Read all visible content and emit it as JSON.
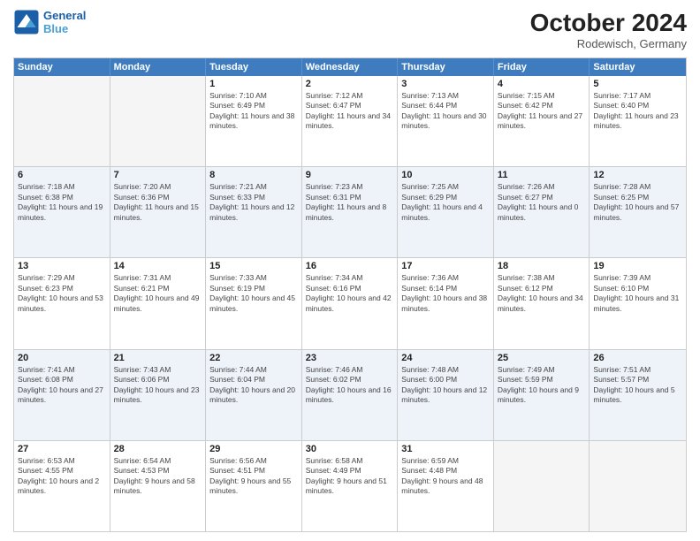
{
  "header": {
    "logo_text_line1": "General",
    "logo_text_line2": "Blue",
    "month": "October 2024",
    "location": "Rodewisch, Germany"
  },
  "weekdays": [
    "Sunday",
    "Monday",
    "Tuesday",
    "Wednesday",
    "Thursday",
    "Friday",
    "Saturday"
  ],
  "weeks": [
    [
      {
        "day": "",
        "info": "",
        "empty": true
      },
      {
        "day": "",
        "info": "",
        "empty": true
      },
      {
        "day": "1",
        "info": "Sunrise: 7:10 AM\nSunset: 6:49 PM\nDaylight: 11 hours and 38 minutes."
      },
      {
        "day": "2",
        "info": "Sunrise: 7:12 AM\nSunset: 6:47 PM\nDaylight: 11 hours and 34 minutes."
      },
      {
        "day": "3",
        "info": "Sunrise: 7:13 AM\nSunset: 6:44 PM\nDaylight: 11 hours and 30 minutes."
      },
      {
        "day": "4",
        "info": "Sunrise: 7:15 AM\nSunset: 6:42 PM\nDaylight: 11 hours and 27 minutes."
      },
      {
        "day": "5",
        "info": "Sunrise: 7:17 AM\nSunset: 6:40 PM\nDaylight: 11 hours and 23 minutes."
      }
    ],
    [
      {
        "day": "6",
        "info": "Sunrise: 7:18 AM\nSunset: 6:38 PM\nDaylight: 11 hours and 19 minutes."
      },
      {
        "day": "7",
        "info": "Sunrise: 7:20 AM\nSunset: 6:36 PM\nDaylight: 11 hours and 15 minutes."
      },
      {
        "day": "8",
        "info": "Sunrise: 7:21 AM\nSunset: 6:33 PM\nDaylight: 11 hours and 12 minutes."
      },
      {
        "day": "9",
        "info": "Sunrise: 7:23 AM\nSunset: 6:31 PM\nDaylight: 11 hours and 8 minutes."
      },
      {
        "day": "10",
        "info": "Sunrise: 7:25 AM\nSunset: 6:29 PM\nDaylight: 11 hours and 4 minutes."
      },
      {
        "day": "11",
        "info": "Sunrise: 7:26 AM\nSunset: 6:27 PM\nDaylight: 11 hours and 0 minutes."
      },
      {
        "day": "12",
        "info": "Sunrise: 7:28 AM\nSunset: 6:25 PM\nDaylight: 10 hours and 57 minutes."
      }
    ],
    [
      {
        "day": "13",
        "info": "Sunrise: 7:29 AM\nSunset: 6:23 PM\nDaylight: 10 hours and 53 minutes."
      },
      {
        "day": "14",
        "info": "Sunrise: 7:31 AM\nSunset: 6:21 PM\nDaylight: 10 hours and 49 minutes."
      },
      {
        "day": "15",
        "info": "Sunrise: 7:33 AM\nSunset: 6:19 PM\nDaylight: 10 hours and 45 minutes."
      },
      {
        "day": "16",
        "info": "Sunrise: 7:34 AM\nSunset: 6:16 PM\nDaylight: 10 hours and 42 minutes."
      },
      {
        "day": "17",
        "info": "Sunrise: 7:36 AM\nSunset: 6:14 PM\nDaylight: 10 hours and 38 minutes."
      },
      {
        "day": "18",
        "info": "Sunrise: 7:38 AM\nSunset: 6:12 PM\nDaylight: 10 hours and 34 minutes."
      },
      {
        "day": "19",
        "info": "Sunrise: 7:39 AM\nSunset: 6:10 PM\nDaylight: 10 hours and 31 minutes."
      }
    ],
    [
      {
        "day": "20",
        "info": "Sunrise: 7:41 AM\nSunset: 6:08 PM\nDaylight: 10 hours and 27 minutes."
      },
      {
        "day": "21",
        "info": "Sunrise: 7:43 AM\nSunset: 6:06 PM\nDaylight: 10 hours and 23 minutes."
      },
      {
        "day": "22",
        "info": "Sunrise: 7:44 AM\nSunset: 6:04 PM\nDaylight: 10 hours and 20 minutes."
      },
      {
        "day": "23",
        "info": "Sunrise: 7:46 AM\nSunset: 6:02 PM\nDaylight: 10 hours and 16 minutes."
      },
      {
        "day": "24",
        "info": "Sunrise: 7:48 AM\nSunset: 6:00 PM\nDaylight: 10 hours and 12 minutes."
      },
      {
        "day": "25",
        "info": "Sunrise: 7:49 AM\nSunset: 5:59 PM\nDaylight: 10 hours and 9 minutes."
      },
      {
        "day": "26",
        "info": "Sunrise: 7:51 AM\nSunset: 5:57 PM\nDaylight: 10 hours and 5 minutes."
      }
    ],
    [
      {
        "day": "27",
        "info": "Sunrise: 6:53 AM\nSunset: 4:55 PM\nDaylight: 10 hours and 2 minutes."
      },
      {
        "day": "28",
        "info": "Sunrise: 6:54 AM\nSunset: 4:53 PM\nDaylight: 9 hours and 58 minutes."
      },
      {
        "day": "29",
        "info": "Sunrise: 6:56 AM\nSunset: 4:51 PM\nDaylight: 9 hours and 55 minutes."
      },
      {
        "day": "30",
        "info": "Sunrise: 6:58 AM\nSunset: 4:49 PM\nDaylight: 9 hours and 51 minutes."
      },
      {
        "day": "31",
        "info": "Sunrise: 6:59 AM\nSunset: 4:48 PM\nDaylight: 9 hours and 48 minutes."
      },
      {
        "day": "",
        "info": "",
        "empty": true
      },
      {
        "day": "",
        "info": "",
        "empty": true
      }
    ]
  ],
  "alt_rows": [
    1,
    3
  ]
}
